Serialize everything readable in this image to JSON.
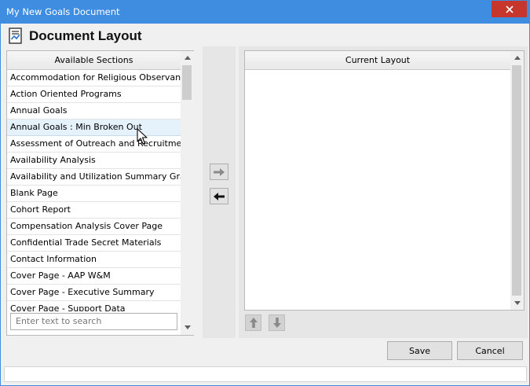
{
  "window": {
    "title": "My New Goals Document",
    "close_icon": "close-icon"
  },
  "header": {
    "icon": "document-chart-icon",
    "title": "Document Layout"
  },
  "available": {
    "header": "Available Sections",
    "items": [
      "Accommodation for Religious Observanc...",
      "Action Oriented Programs",
      "Annual Goals",
      "Annual Goals : Min Broken Out",
      "Assessment of Outreach and Recruitment",
      "Availability Analysis",
      "Availability and Utilization Summary Graph",
      "Blank Page",
      "Cohort Report",
      "Compensation Analysis Cover Page",
      "Confidential Trade Secret Materials",
      "Contact Information",
      "Cover Page - AAP W&M",
      "Cover Page - Executive Summary",
      "Cover Page - Support Data"
    ],
    "hovered_index": 3,
    "search_placeholder": "Enter text to search"
  },
  "transfer": {
    "add_icon": "arrow-right-icon",
    "remove_icon": "arrow-left-icon"
  },
  "current": {
    "header": "Current Layout",
    "items": [],
    "move_up_icon": "arrow-up-icon",
    "move_down_icon": "arrow-down-icon"
  },
  "buttons": {
    "save": "Save",
    "cancel": "Cancel"
  },
  "colors": {
    "title_bar": "#3f8de0",
    "close_button": "#c7362c",
    "hover_row": "#e5f1fb"
  }
}
